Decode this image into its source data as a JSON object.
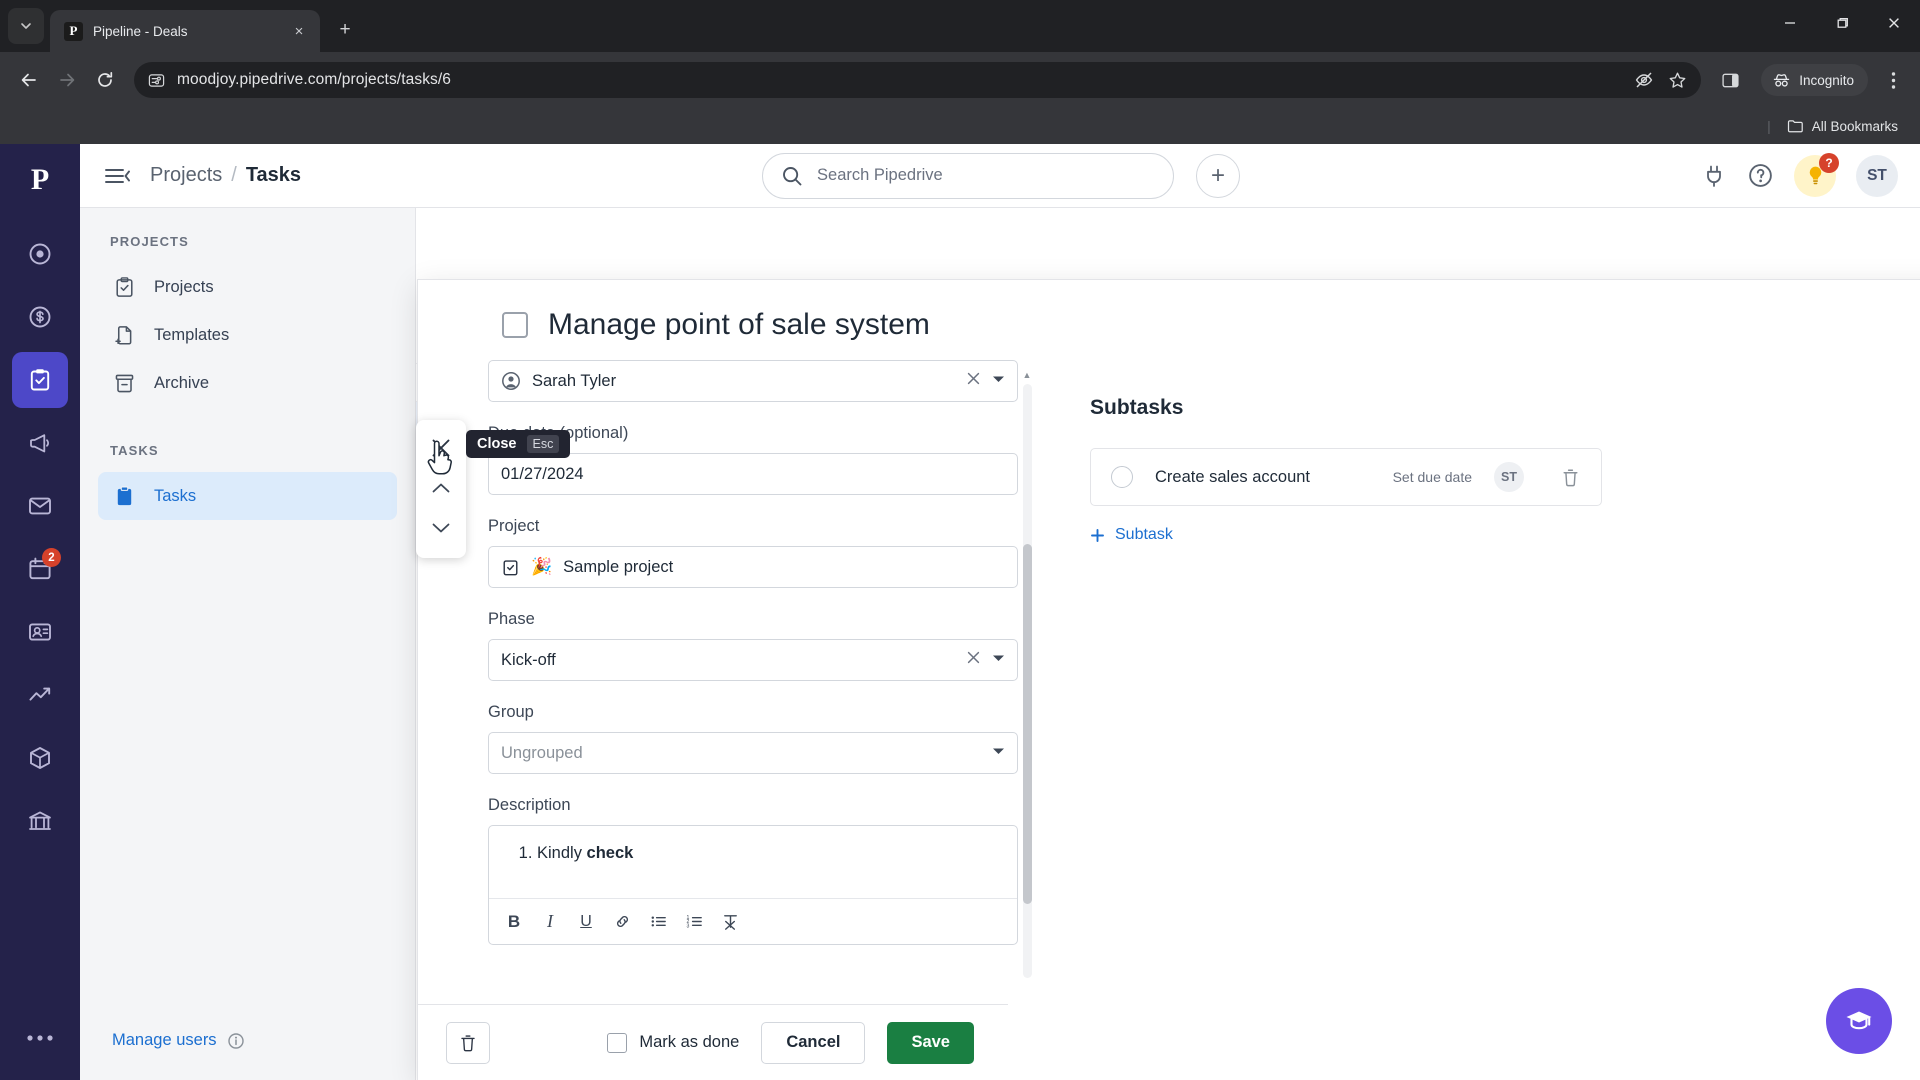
{
  "browser": {
    "tab": {
      "title": "Pipeline - Deals",
      "favicon_letter": "P",
      "close_label": "×"
    },
    "new_tab_label": "+",
    "window": {
      "minimize": "–",
      "maximize": "❐",
      "close": "✕"
    },
    "url": "moodjoy.pipedrive.com/projects/tasks/6",
    "profile_label": "Incognito",
    "bookmarks_label": "All Bookmarks",
    "icons": {
      "back": "back-arrow-icon",
      "forward": "forward-arrow-icon",
      "reload": "reload-icon",
      "site_info": "site-settings-icon",
      "tracking": "eye-off-icon",
      "bookmark": "star-icon",
      "side_panel": "side-panel-icon",
      "incognito": "incognito-icon",
      "menu": "kebab-menu-icon"
    }
  },
  "app": {
    "logo_letter": "P",
    "breadcrumb": {
      "parent": "Projects",
      "separator": "/",
      "current": "Tasks"
    },
    "search": {
      "placeholder": "Search Pipedrive"
    },
    "add_label": "+",
    "notification_count": "2",
    "bulb_badge": "?",
    "user_initials": "ST"
  },
  "sidebar": {
    "projects_heading": "PROJECTS",
    "projects_items": [
      {
        "label": "Projects",
        "icon": "clipboard-check-icon"
      },
      {
        "label": "Templates",
        "icon": "file-plus-icon"
      },
      {
        "label": "Archive",
        "icon": "archive-icon"
      }
    ],
    "tasks_heading": "TASKS",
    "tasks_items": [
      {
        "label": "Tasks",
        "icon": "clipboard-filled-icon",
        "active": true
      }
    ],
    "manage_users": "Manage users"
  },
  "tooltip": {
    "label": "Close",
    "key": "Esc"
  },
  "modal": {
    "title": "Manage point of sale system",
    "fields": {
      "assignee": {
        "value": "Sarah Tyler"
      },
      "due_date": {
        "label": "Due date (optional)",
        "value": "01/27/2024"
      },
      "project": {
        "label": "Project",
        "value": "Sample project",
        "emoji": "🎉"
      },
      "phase": {
        "label": "Phase",
        "value": "Kick-off"
      },
      "group": {
        "label": "Group",
        "placeholder": "Ungrouped"
      },
      "description": {
        "label": "Description",
        "list_number": "1.",
        "text_plain": "Kindly ",
        "text_bold": "check"
      }
    },
    "editor_toolbar": [
      {
        "name": "bold-icon",
        "glyph": "B"
      },
      {
        "name": "italic-icon",
        "glyph": "I"
      },
      {
        "name": "underline-icon",
        "glyph": "U"
      },
      {
        "name": "link-icon",
        "glyph": "🔗"
      },
      {
        "name": "bullet-list-icon",
        "glyph": "•"
      },
      {
        "name": "numbered-list-icon",
        "glyph": "1"
      },
      {
        "name": "clear-format-icon",
        "glyph": "✗"
      }
    ],
    "subtasks": {
      "heading": "Subtasks",
      "rows": [
        {
          "name": "Create sales account",
          "due": "Set due date",
          "avatar": "ST"
        }
      ],
      "add_label": "Subtask",
      "add_icon": "plus-icon"
    },
    "footer": {
      "delete_icon": "trash-icon",
      "mark_as_done": "Mark as done",
      "cancel": "Cancel",
      "save": "Save"
    }
  },
  "colors": {
    "brand_purple": "#24224a",
    "accent_blue": "#1c6fd0",
    "save_green": "#1a7f42",
    "badge_red": "#d6422b"
  }
}
